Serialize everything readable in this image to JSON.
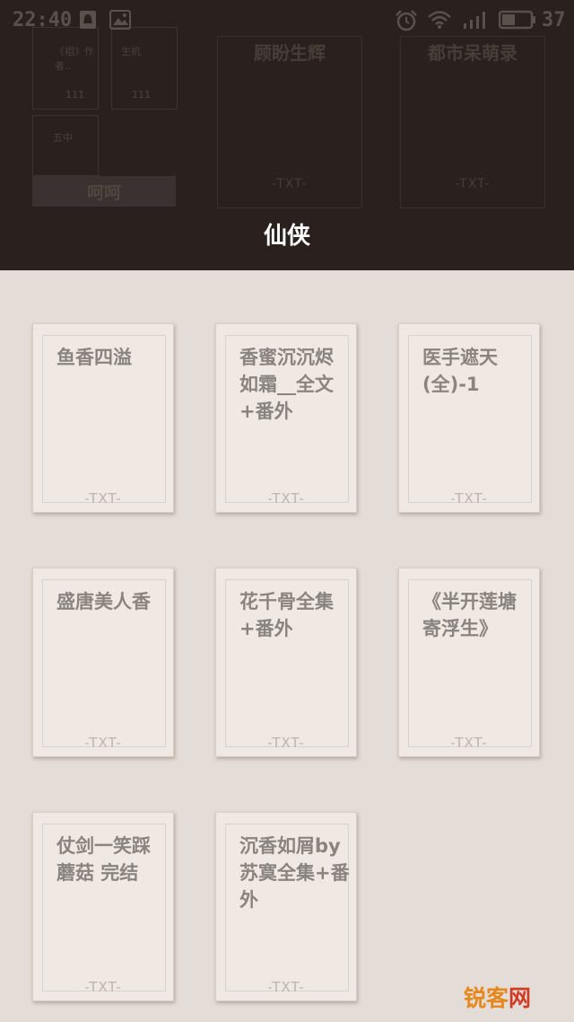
{
  "status_bar": {
    "time": "22:40",
    "battery_level": "37",
    "icons": [
      "notification-bell-icon",
      "image-icon",
      "alarm-icon",
      "wifi-icon",
      "signal-icon",
      "battery-icon"
    ]
  },
  "background_shelf": {
    "books": [
      {
        "title": "顾盼生辉",
        "tag": "-TXT-"
      },
      {
        "title": "都市呆萌录",
        "tag": "-TXT-"
      }
    ],
    "mini_items": [
      "《相》作者..",
      "生机",
      "斗",
      "111",
      "五中"
    ],
    "button_label": "呵呵"
  },
  "category": {
    "title": "仙侠"
  },
  "books": [
    {
      "title": "鱼香四溢",
      "tag": "-TXT-"
    },
    {
      "title": "香蜜沉沉烬如霜__全文+番外",
      "tag": "-TXT-"
    },
    {
      "title": "医手遮天(全)-1",
      "tag": "-TXT-"
    },
    {
      "title": "盛唐美人香",
      "tag": "-TXT-"
    },
    {
      "title": "花千骨全集+番外",
      "tag": "-TXT-"
    },
    {
      "title": "《半开莲塘寄浮生》",
      "tag": "-TXT-"
    },
    {
      "title": "仗剑一笑踩蘑菇 完结",
      "tag": "-TXT-"
    },
    {
      "title": "沉香如屑by苏寞全集+番外",
      "tag": "-TXT-"
    }
  ],
  "watermark": {
    "part1": "锐客",
    "part2": "网"
  },
  "colors": {
    "header_bg": "#2a211f",
    "page_bg": "#e4dcd6",
    "card_bg": "#f0e8e3",
    "title_text": "#8a8480"
  }
}
